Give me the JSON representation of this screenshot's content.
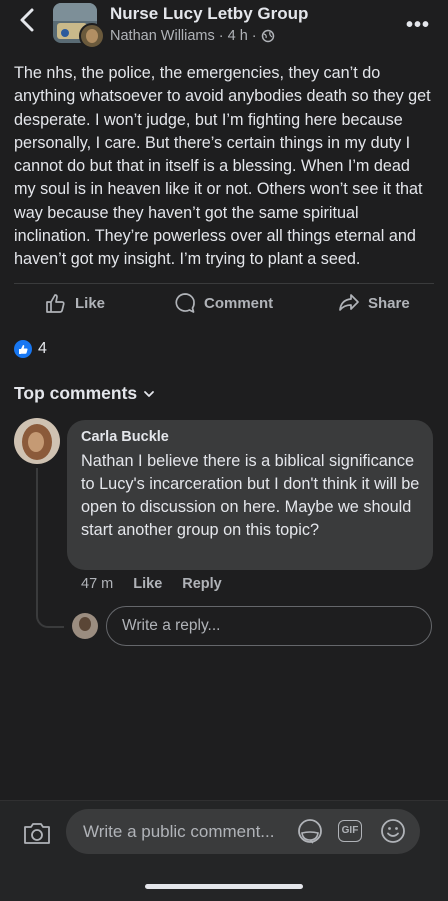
{
  "header": {
    "group_name": "Nurse Lucy Letby Group",
    "author": "Nathan Williams",
    "time": "· 4 h ·",
    "more": "•••"
  },
  "post": {
    "text": "The nhs, the police, the emergencies, they can’t do anything whatsoever to avoid anybodies death so they get desperate. I won’t judge, but I’m fighting here because personally, I care. But there’s certain things in my duty I cannot do but that in itself is a blessing. When I’m dead my soul is in heaven like it or not. Others won’t see it that way because they haven’t got the same spiritual inclination. They’re powerless over all things eternal and haven’t got my insight. I’m trying to plant a seed."
  },
  "actions": {
    "like": "Like",
    "comment": "Comment",
    "share": "Share"
  },
  "reactions": {
    "count": "4"
  },
  "comments_header": "Top comments",
  "comment": {
    "author": "Carla Buckle",
    "text": "Nathan I believe there is a biblical significance to Lucy's incarceration but I don't think it will be open to discussion on here. Maybe we should start another group on this topic?",
    "time": "47 m",
    "like": "Like",
    "reply": "Reply"
  },
  "reply_input": {
    "placeholder": "Write a reply..."
  },
  "comment_input": {
    "placeholder": "Write a public comment..."
  },
  "gif_label": "GIF",
  "colors": {
    "background": "#1e1e1f",
    "bubble": "#3a3b3c",
    "accent": "#1877f2"
  }
}
